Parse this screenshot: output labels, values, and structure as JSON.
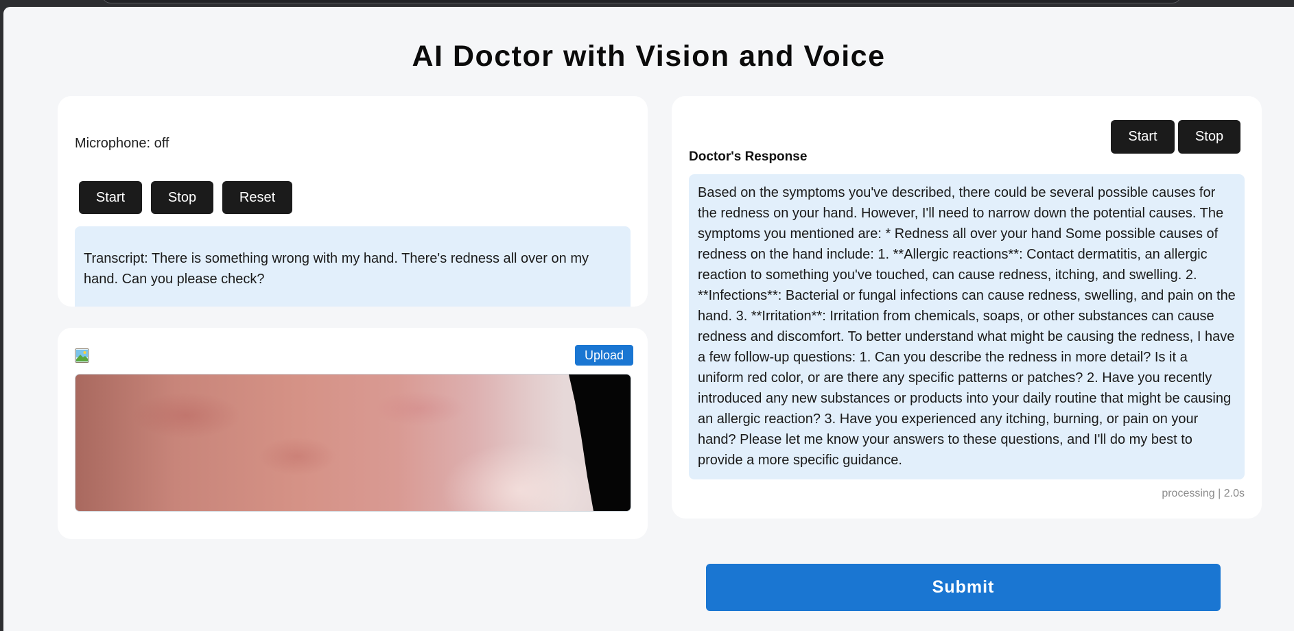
{
  "app": {
    "title": "AI Doctor with Vision and Voice"
  },
  "voice": {
    "microphone_status": "Microphone: off",
    "start_label": "Start",
    "stop_label": "Stop",
    "reset_label": "Reset",
    "transcript": "Transcript: There is something wrong with my hand. There's redness all over on my hand. Can you please check?"
  },
  "image_input": {
    "icon": "image-icon",
    "upload_label": "Upload"
  },
  "response": {
    "start_label": "Start",
    "stop_label": "Stop",
    "heading": "Doctor's Response",
    "text": "Based on the symptoms you've described, there could be several possible causes for the redness on your hand. However, I'll need to narrow down the potential causes. The symptoms you mentioned are: * Redness all over your hand Some possible causes of redness on the hand include: 1. **Allergic reactions**: Contact dermatitis, an allergic reaction to something you've touched, can cause redness, itching, and swelling. 2. **Infections**: Bacterial or fungal infections can cause redness, swelling, and pain on the hand. 3. **Irritation**: Irritation from chemicals, soaps, or other substances can cause redness and discomfort. To better understand what might be causing the redness, I have a few follow-up questions: 1. Can you describe the redness in more detail? Is it a uniform red color, or are there any specific patterns or patches? 2. Have you recently introduced any new substances or products into your daily routine that might be causing an allergic reaction? 3. Have you experienced any itching, burning, or pain on your hand? Please let me know your answers to these questions, and I'll do my best to provide a more specific guidance.",
    "status": "processing | 2.0s"
  },
  "submit": {
    "label": "Submit"
  },
  "colors": {
    "accent": "#1a76d2",
    "dark_button": "#1b1b1b",
    "text_box": "#e2effb",
    "page_bg": "#f5f6f8"
  }
}
